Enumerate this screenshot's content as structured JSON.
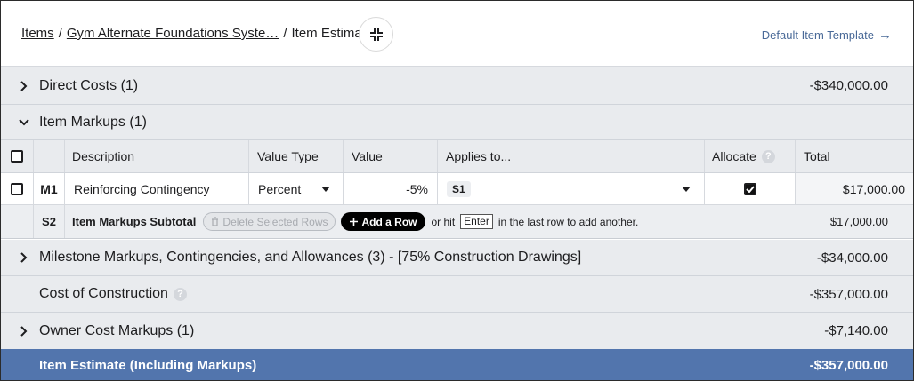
{
  "breadcrumb": {
    "items_link": "Items",
    "project_link": "Gym Alternate Foundations Syste…",
    "current": "Item Estimate",
    "separator": "/"
  },
  "header": {
    "collapse_icon": "collapse-arrows-icon",
    "template_link": "Default Item Template",
    "template_arrow": "→"
  },
  "sections": {
    "direct_costs": {
      "label": "Direct Costs (1)",
      "amount": "-$340,000.00"
    },
    "item_markups": {
      "label": "Item Markups (1)"
    },
    "milestone": {
      "label": "Milestone Markups, Contingencies, and Allowances (3) - [75% Construction Drawings]",
      "amount": "-$34,000.00"
    },
    "cost_of_construction": {
      "label": "Cost of Construction",
      "amount": "-$357,000.00"
    },
    "owner_cost": {
      "label": "Owner Cost Markups (1)",
      "amount": "-$7,140.00"
    },
    "item_estimate": {
      "label": "Item Estimate (Including Markups)",
      "amount": "-$357,000.00"
    }
  },
  "table": {
    "columns": {
      "description": "Description",
      "value_type": "Value Type",
      "value": "Value",
      "applies_to": "Applies to...",
      "allocate": "Allocate",
      "total": "Total"
    },
    "row": {
      "id": "M1",
      "description": "Reinforcing Contingency",
      "value_type": "Percent",
      "value": "-5%",
      "applies_to": "S1",
      "allocate": true,
      "total": "$17,000.00"
    },
    "subtotal": {
      "id": "S2",
      "label": "Item Markups Subtotal",
      "delete_button": "Delete Selected Rows",
      "add_button": "Add a Row",
      "or_hit": "or hit",
      "key": "Enter",
      "hint": "in the last row to add another.",
      "total": "$17,000.00"
    }
  },
  "help_glyph": "?",
  "colors": {
    "accent": "#5275ad",
    "band": "#e9ebee",
    "link": "#4a6a98"
  }
}
